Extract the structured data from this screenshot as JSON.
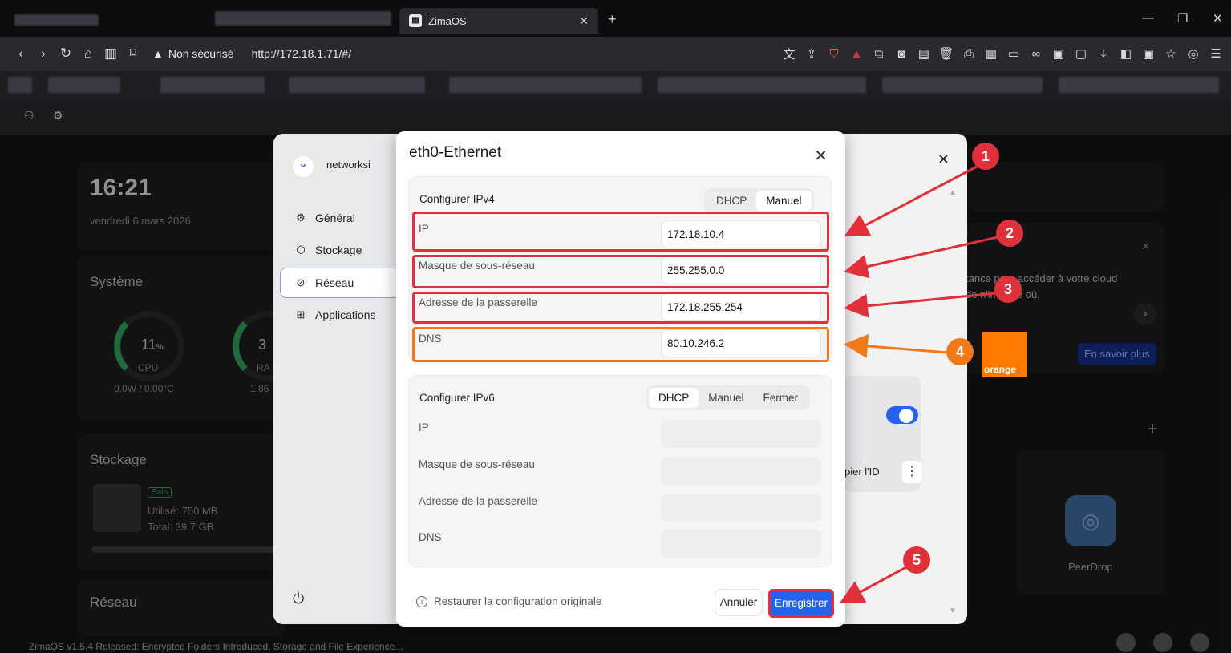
{
  "browser": {
    "tab_title": "ZimaOS",
    "favicon": "zimaos-icon",
    "security_label": "Non sécurisé",
    "url": "http://172.18.1.71/#/"
  },
  "dashboard": {
    "time": "16:21",
    "date": "vendredi 6 mars 2026",
    "system_title": "Système",
    "cpu_percent": "11",
    "cpu_unit": "%",
    "cpu_label": "CPU",
    "cpu_power": "0.0W / 0.00°C",
    "ram_partial": "3",
    "ram_label_partial": "RA",
    "ram_sub_partial": "1.86",
    "storage_title": "Stockage",
    "storage_badge": "Sain",
    "storage_used": "Utilisé: 750 MB",
    "storage_total": "Total: 39.7 GB",
    "network_title": "Réseau",
    "cloud_text_1": "tance pour accéder à votre cloud",
    "cloud_text_2": "de n'importe où.",
    "learn_more": "En savoir plus",
    "copy_id_partial": "pier l'ID",
    "peerdrop": "PeerDrop",
    "status_news": "ZimaOS v1.5.4 Released: Encrypted Folders Introduced, Storage and File Experience..."
  },
  "settings": {
    "device_name": "networksi",
    "menu": [
      {
        "label": "Général",
        "icon": "gear-icon"
      },
      {
        "label": "Stockage",
        "icon": "cube-icon"
      },
      {
        "label": "Réseau",
        "icon": "network-icon"
      },
      {
        "label": "Applications",
        "icon": "grid-icon"
      }
    ]
  },
  "dialog": {
    "title": "eth0-Ethernet",
    "ipv4": {
      "title": "Configurer IPv4",
      "modes": [
        "DHCP",
        "Manuel"
      ],
      "selected": "Manuel",
      "fields": [
        {
          "label": "IP",
          "value": "172.18.10.4"
        },
        {
          "label": "Masque de sous-réseau",
          "value": "255.255.0.0"
        },
        {
          "label": "Adresse de la passerelle",
          "value": "172.18.255.254"
        },
        {
          "label": "DNS",
          "value": "80.10.246.2"
        }
      ]
    },
    "ipv6": {
      "title": "Configurer IPv6",
      "modes": [
        "DHCP",
        "Manuel",
        "Fermer"
      ],
      "selected": "DHCP",
      "fields": [
        {
          "label": "IP",
          "value": ""
        },
        {
          "label": "Masque de sous-réseau",
          "value": ""
        },
        {
          "label": "Adresse de la passerelle",
          "value": ""
        },
        {
          "label": "DNS",
          "value": ""
        }
      ]
    },
    "restore": "Restaurer la configuration originale",
    "cancel": "Annuler",
    "save": "Enregistrer"
  },
  "annotations": {
    "badges": [
      "1",
      "2",
      "3",
      "4",
      "5"
    ],
    "brand_logo_text": "orange",
    "highlight_red": "#e0313b",
    "highlight_orange": "#f07a1a"
  }
}
